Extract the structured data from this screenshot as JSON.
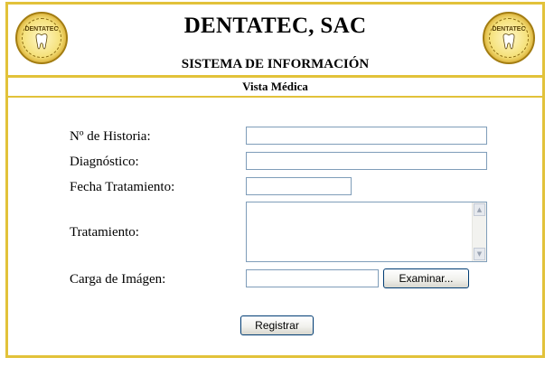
{
  "header": {
    "logo_text": "DENTATEC",
    "title": "DENTATEC, SAC",
    "subtitle": "SISTEMA DE INFORMACIÓN",
    "section": "Vista Médica"
  },
  "form": {
    "historia": {
      "label": "Nº de Historia:",
      "value": ""
    },
    "diagnostico": {
      "label": "Diagnóstico:",
      "value": ""
    },
    "fecha": {
      "label": "Fecha Tratamiento:",
      "value": ""
    },
    "tratamiento": {
      "label": "Tratamiento:",
      "value": ""
    },
    "carga": {
      "label": "Carga de Imágen:",
      "value": "",
      "browse_label": "Examinar..."
    },
    "submit_label": "Registrar"
  },
  "colors": {
    "border": "#e2c23a",
    "input_border": "#7f9db9",
    "button_border": "#003c74"
  },
  "icons": [
    "logo-seal-icon",
    "tooth-icon",
    "scroll-up-icon",
    "scroll-down-icon"
  ]
}
